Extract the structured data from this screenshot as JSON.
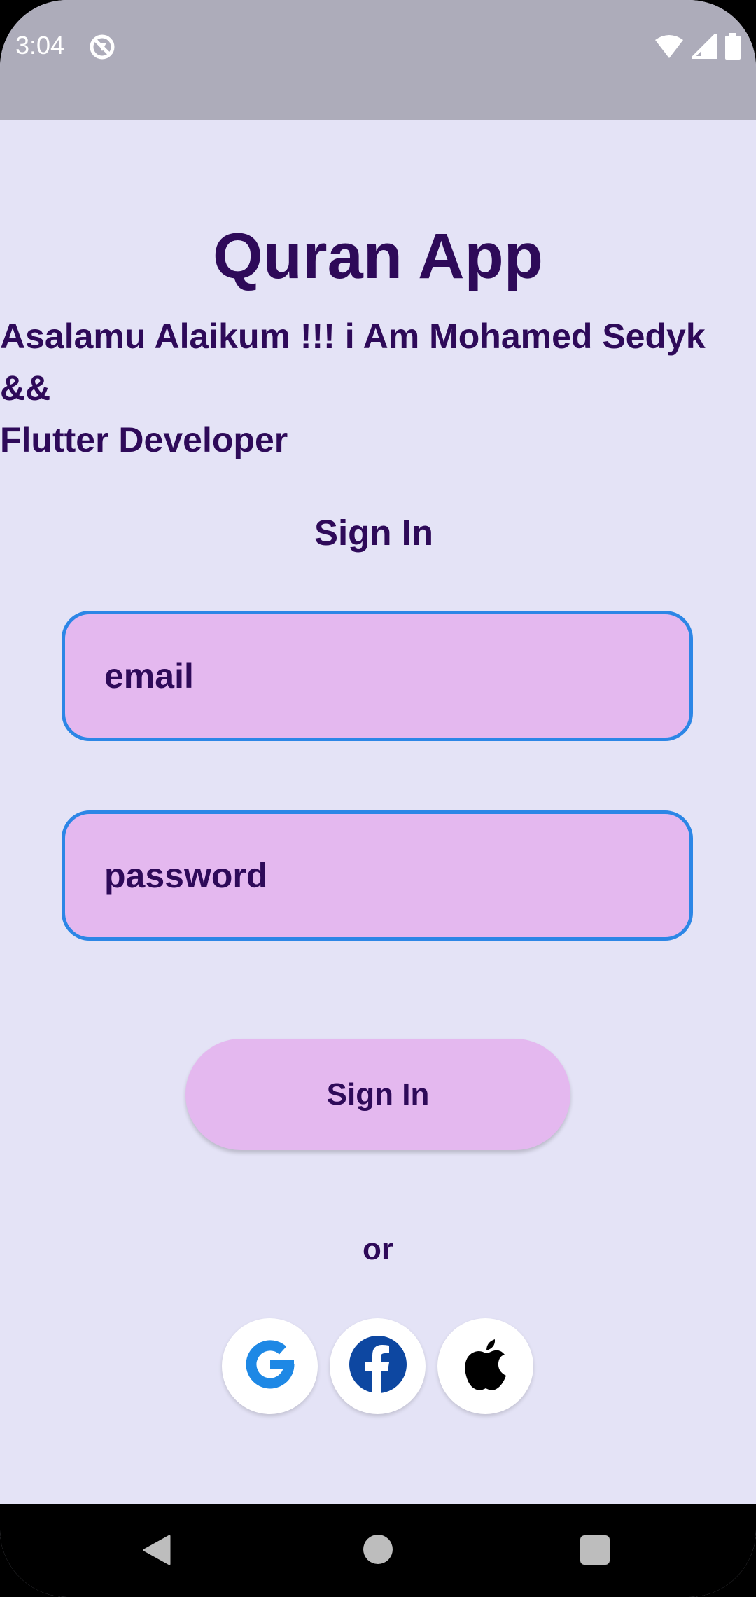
{
  "status_bar": {
    "time": "3:04",
    "app_icon": "no-location-icon",
    "icons": [
      "wifi-icon",
      "cellular-signal-icon",
      "battery-icon"
    ],
    "background": "#ADACBA"
  },
  "header": {
    "title": "Quran App",
    "greeting": "Asalamu Alaikum !!! i Am Mohamed Sedyk &&\nFlutter Developer"
  },
  "form": {
    "heading": "Sign In",
    "email": {
      "placeholder": "email",
      "value": ""
    },
    "password": {
      "placeholder": "password",
      "value": ""
    },
    "submit_label": "Sign In"
  },
  "alt_login": {
    "divider_text": "or",
    "providers": [
      {
        "name": "Google",
        "icon": "google-icon"
      },
      {
        "name": "Facebook",
        "icon": "facebook-icon"
      },
      {
        "name": "Apple",
        "icon": "apple-icon"
      }
    ]
  },
  "nav_bar": {
    "buttons": [
      "back-icon",
      "home-icon",
      "recents-icon"
    ]
  },
  "colors": {
    "background": "#E4E3F6",
    "text": "#2E0A59",
    "field_fill": "#E4B8EF",
    "field_border": "#2C86E6",
    "google_blue": "#1E88E5",
    "facebook_blue": "#0D47A1"
  }
}
